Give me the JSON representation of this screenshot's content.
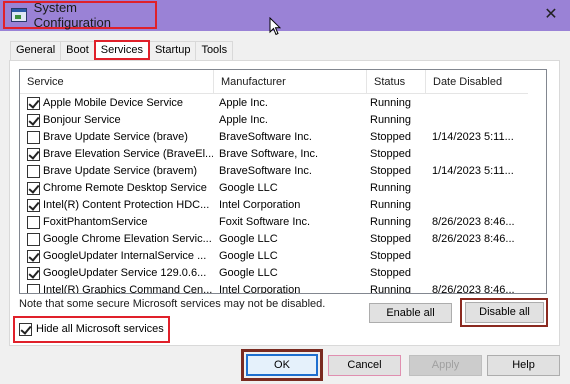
{
  "window": {
    "title": "System Configuration",
    "icon": "msconfig-icon",
    "close_glyph": "✕"
  },
  "tabs": [
    {
      "label": "General"
    },
    {
      "label": "Boot"
    },
    {
      "label": "Services"
    },
    {
      "label": "Startup"
    },
    {
      "label": "Tools"
    }
  ],
  "active_tab": "Services",
  "columns": {
    "service": "Service",
    "manufacturer": "Manufacturer",
    "status": "Status",
    "date_disabled": "Date Disabled"
  },
  "services": [
    {
      "checked": true,
      "name": "Apple Mobile Device Service",
      "manufacturer": "Apple Inc.",
      "status": "Running",
      "date_disabled": ""
    },
    {
      "checked": true,
      "name": "Bonjour Service",
      "manufacturer": "Apple Inc.",
      "status": "Running",
      "date_disabled": ""
    },
    {
      "checked": false,
      "name": "Brave Update Service (brave)",
      "manufacturer": "BraveSoftware Inc.",
      "status": "Stopped",
      "date_disabled": "1/14/2023 5:11..."
    },
    {
      "checked": true,
      "name": "Brave Elevation Service (BraveEl...",
      "manufacturer": "Brave Software, Inc.",
      "status": "Stopped",
      "date_disabled": ""
    },
    {
      "checked": false,
      "name": "Brave Update Service (bravem)",
      "manufacturer": "BraveSoftware Inc.",
      "status": "Stopped",
      "date_disabled": "1/14/2023 5:11..."
    },
    {
      "checked": true,
      "name": "Chrome Remote Desktop Service",
      "manufacturer": "Google LLC",
      "status": "Running",
      "date_disabled": ""
    },
    {
      "checked": true,
      "name": "Intel(R) Content Protection HDC...",
      "manufacturer": "Intel Corporation",
      "status": "Running",
      "date_disabled": ""
    },
    {
      "checked": false,
      "name": "FoxitPhantomService",
      "manufacturer": "Foxit Software Inc.",
      "status": "Running",
      "date_disabled": "8/26/2023 8:46..."
    },
    {
      "checked": false,
      "name": "Google Chrome Elevation Servic...",
      "manufacturer": "Google LLC",
      "status": "Stopped",
      "date_disabled": "8/26/2023 8:46..."
    },
    {
      "checked": true,
      "name": "GoogleUpdater InternalService ...",
      "manufacturer": "Google LLC",
      "status": "Stopped",
      "date_disabled": ""
    },
    {
      "checked": true,
      "name": "GoogleUpdater Service 129.0.6...",
      "manufacturer": "Google LLC",
      "status": "Stopped",
      "date_disabled": ""
    },
    {
      "checked": false,
      "name": "Intel(R) Graphics Command Cen...",
      "manufacturer": "Intel Corporation",
      "status": "Running",
      "date_disabled": "8/26/2023 8:46..."
    }
  ],
  "note": "Note that some secure Microsoft services may not be disabled.",
  "buttons": {
    "enable_all": "Enable all",
    "disable_all": "Disable all",
    "ok": "OK",
    "cancel": "Cancel",
    "apply": "Apply",
    "help": "Help"
  },
  "hide_ms": {
    "label": "Hide all Microsoft services",
    "checked": true
  },
  "scroll": {
    "up": "▲",
    "down": "▼"
  },
  "colors": {
    "titlebar": "#9a82d6",
    "highlight_red": "#e0202a",
    "highlight_dark": "#8b2a20",
    "focus_blue": "#1e6fcf"
  }
}
